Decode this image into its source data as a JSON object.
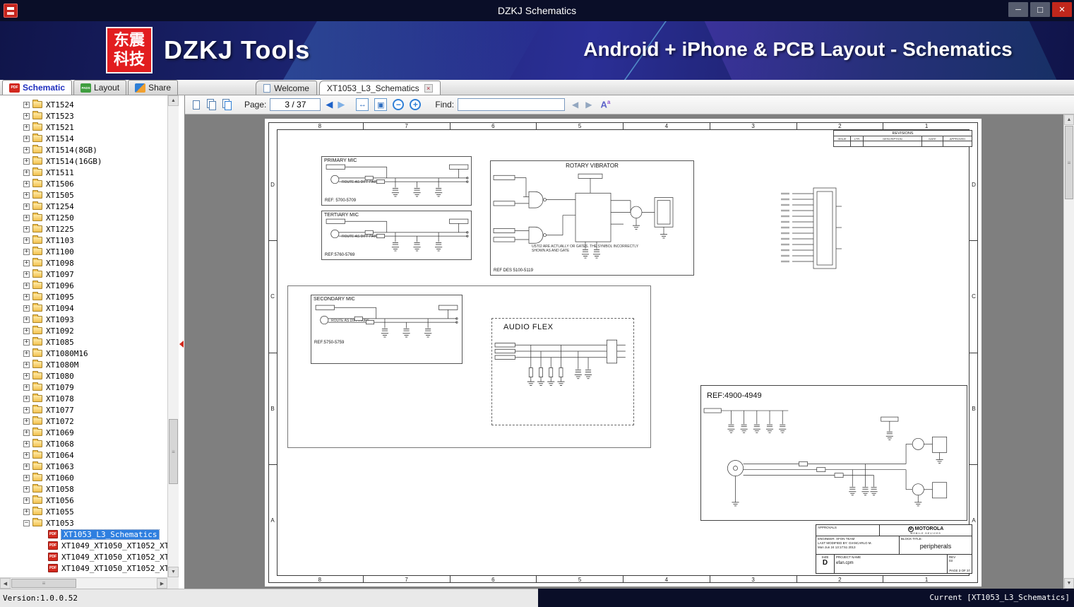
{
  "window": {
    "title": "DZKJ Schematics"
  },
  "banner": {
    "logo_text": "东震科技",
    "app_title": "DZKJ Tools",
    "subtitle": "Android + iPhone & PCB Layout - Schematics"
  },
  "tabs": {
    "tools": [
      {
        "label": "Schematic",
        "badge": "PDF",
        "active": true
      },
      {
        "label": "Layout",
        "badge": "PADS",
        "active": false
      },
      {
        "label": "Share",
        "badge": "S",
        "active": false
      }
    ],
    "docs": [
      {
        "label": "Welcome",
        "active": false,
        "icon": true,
        "closable": false
      },
      {
        "label": "XT1053_L3_Schematics",
        "active": true,
        "icon": false,
        "closable": true
      }
    ]
  },
  "sidebar": {
    "pdf_badge": "PDF",
    "folders": [
      "XT1524",
      "XT1523",
      "XT1521",
      "XT1514",
      "XT1514(8GB)",
      "XT1514(16GB)",
      "XT1511",
      "XT1506",
      "XT1505",
      "XT1254",
      "XT1250",
      "XT1225",
      "XT1103",
      "XT1100",
      "XT1098",
      "XT1097",
      "XT1096",
      "XT1095",
      "XT1094",
      "XT1093",
      "XT1092",
      "XT1085",
      "XT1080M16",
      "XT1080M",
      "XT1080",
      "XT1079",
      "XT1078",
      "XT1077",
      "XT1072",
      "XT1069",
      "XT1068",
      "XT1064",
      "XT1063",
      "XT1060",
      "XT1058",
      "XT1056",
      "XT1055"
    ],
    "expanded_folder": "XT1053",
    "documents": [
      {
        "label": "XT1053_L3_Schematics",
        "selected": true
      },
      {
        "label": "XT1049_XT1050_XT1052_XT10",
        "selected": false
      },
      {
        "label": "XT1049_XT1050_XT1052_XT10",
        "selected": false
      },
      {
        "label": "XT1049_XT1050_XT1052_XT10",
        "selected": false
      }
    ]
  },
  "toolbar": {
    "page_label": "Page:",
    "page_value": "3 / 37",
    "find_label": "Find:",
    "find_value": "",
    "font_icon_main": "A",
    "font_icon_sup": "a"
  },
  "viewer": {
    "column_labels": [
      "8",
      "7",
      "6",
      "5",
      "4",
      "3",
      "2",
      "1"
    ],
    "row_labels": [
      "D",
      "C",
      "B",
      "A"
    ],
    "blocks": {
      "primary_mic": {
        "title": "PRIMARY MIC",
        "note": "ROUTE AS DIFF PAIRS",
        "ref": "REF: 5700-5709"
      },
      "tertiary_mic": {
        "title": "TERTIARY MIC",
        "note": "ROUTE AS DIFF PAIRS",
        "ref": "REF:5760-5769"
      },
      "rotary_vibrator": {
        "title": "ROTARY VIBRATOR",
        "note": "U5702 ARE ACTUALLY OR GATES. THE SYMBOL INCORRECTLY SHOWN AS AND GATE",
        "ref": "REF DES 5100-5119"
      },
      "secondary_mic": {
        "title": "SECONDARY MIC",
        "note": "ROUTE AS DIFF PAIRS",
        "ref": "REF:5750-5759"
      },
      "audio_flex": {
        "title": "AUDIO FLEX"
      },
      "headset_jack": {
        "title": "REF:4900-4949"
      }
    },
    "revisions": {
      "title": "REVISIONS",
      "columns": [
        "ISSUE",
        "LTR",
        "DESCRIPTION",
        "DATE",
        "APPROVED"
      ]
    },
    "title_block": {
      "approvals_label": "APPROVALS",
      "brand": "MOTOROLA",
      "brand_sub": "MOBILE DEVICES",
      "engineer_label": "ENGINEER:",
      "engineer": "XFON TEAM",
      "modified_label": "LAST MODIFIED BY:",
      "modified_by": "GIANCARLO M.",
      "modified_date": "Mon Jun 24 13:17:51 2013",
      "block_title_label": "BLOCK TITLE:",
      "block_title": "peripherals",
      "size_label": "SIZE",
      "size": "D",
      "project_label": "PROJECT NAME",
      "project": "efan.cpm",
      "rev_label": "REV",
      "rev": "03",
      "page": "PAGE 3 OF 37"
    }
  },
  "status": {
    "version": "Version:1.0.0.52",
    "current": "Current [XT1053_L3_Schematics]"
  }
}
